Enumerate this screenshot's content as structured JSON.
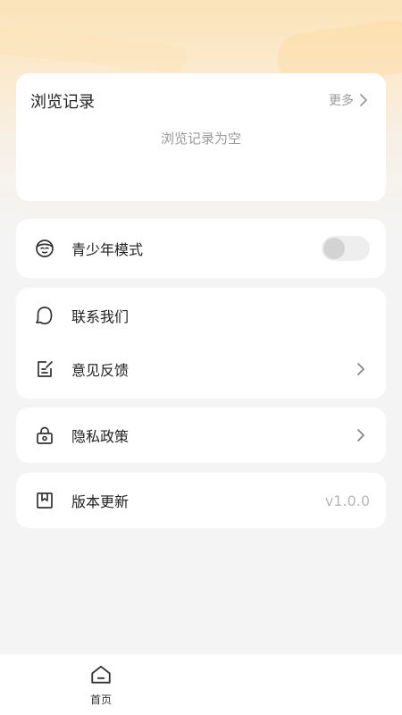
{
  "history": {
    "title": "浏览记录",
    "more_label": "更多",
    "empty_text": "浏览记录为空"
  },
  "menu": {
    "youth_mode": {
      "label": "青少年模式",
      "icon": "youth-mode-icon",
      "enabled": false
    },
    "contact_us": {
      "label": "联系我们",
      "icon": "chat-icon"
    },
    "feedback": {
      "label": "意见反馈",
      "icon": "edit-icon"
    },
    "privacy": {
      "label": "隐私政策",
      "icon": "lock-icon"
    },
    "version": {
      "label": "版本更新",
      "icon": "bookmark-icon",
      "value": "v1.0.0"
    }
  },
  "bottom_nav": {
    "items": [
      {
        "label": "首页",
        "icon": "home-icon",
        "active": true
      }
    ]
  }
}
